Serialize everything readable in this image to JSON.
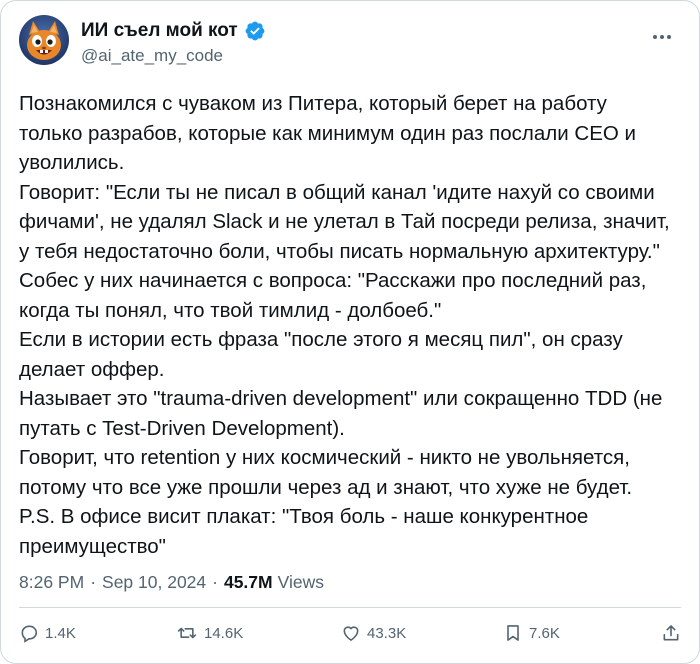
{
  "author": {
    "display_name": "ИИ съел мой кот",
    "handle": "@ai_ate_my_code",
    "verified": true,
    "avatar_icon": "cat-avatar-icon"
  },
  "tweet": {
    "text": "Познакомился с чуваком из Питера, который берет на работу\nтолько разрабов, которые как минимум один раз послали CEO и\nуволились.\nГоворит: \"Если ты не писал в общий канал 'идите нахуй со своими\nфичами', не удалял Slack и не улетал в Тай посреди релиза, значит,\nу тебя недостаточно боли, чтобы писать нормальную архитектуру.\"\nСобес у них начинается с вопроса: \"Расскажи про последний раз,\nкогда ты понял, что твой тимлид - долбоеб.\"\nЕсли в истории есть фраза \"после этого я месяц пил\", он сразу\nделает оффер.\nНазывает это \"trauma-driven development\" или сокращенно TDD (не\nпутать с Test-Driven Development).\nГоворит, что retention у них космический - никто не увольняется,\nпотому что все уже прошли через ад и знают, что хуже не будет.\nP.S. В офисе висит плакат: \"Твоя боль - наше конкурентное\nпреимущество\"",
    "time": "8:26 PM",
    "date": "Sep 10, 2024",
    "views_count": "45.7M",
    "views_label": "Views",
    "separator": "·"
  },
  "actions": {
    "replies": "1.4K",
    "reposts": "14.6K",
    "likes": "43.3K",
    "bookmarks": "7.6K"
  },
  "colors": {
    "text": "#0f1419",
    "secondary": "#536471",
    "verified": "#1d9bf0",
    "border": "#cfd9de"
  }
}
